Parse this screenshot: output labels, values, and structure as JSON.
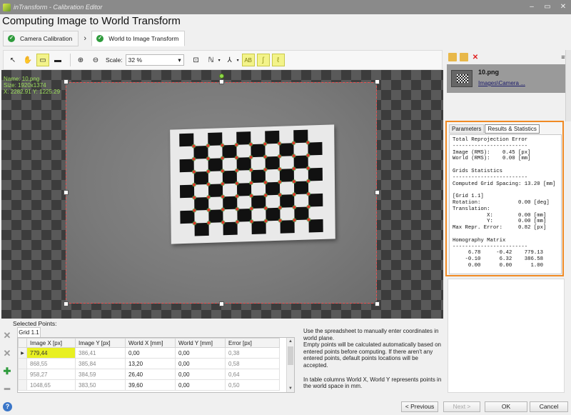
{
  "window": {
    "title": "inTransform - Calibration Editor",
    "controls": [
      "–",
      "▭",
      "✕"
    ]
  },
  "heading": "Computing Image to World Transform",
  "breadcrumb": [
    {
      "label": "Camera Calibration"
    },
    {
      "label": "World to Image Transform"
    }
  ],
  "toolbar": {
    "scale_label": "Scale:",
    "scale_value": "32 %",
    "ab_label": "AB"
  },
  "canvas": {
    "info_name": "Name: 10.png",
    "info_size": "Size: 1920x1374",
    "info_xy": "X: 2282.91 Y: 1225.29"
  },
  "points": {
    "title": "Selected Points:",
    "grid_tab": "Grid 1.1",
    "columns": [
      "Image X [px]",
      "Image Y [px]",
      "World X [mm]",
      "World Y [mm]",
      "Error [px]"
    ],
    "rows": [
      [
        "779,44",
        "386,41",
        "0,00",
        "0,00",
        "0,38"
      ],
      [
        "868,55",
        "385,84",
        "13,20",
        "0,00",
        "0,58"
      ],
      [
        "958,27",
        "384,59",
        "26,40",
        "0,00",
        "0,64"
      ],
      [
        "1048,65",
        "383,50",
        "39,60",
        "0,00",
        "0,50"
      ]
    ]
  },
  "help": {
    "p1": "Use the spreadsheet to manually enter coordinates in world plane.",
    "p2": "Empty points will be calculated automatically based on entered points before computing. If there aren't any entered points, default points locations will be accepted.",
    "p3": "In table columns World X, World Y represents points in the world space in mm."
  },
  "image_list": {
    "name": "10.png",
    "path": "Images\\Camera ..."
  },
  "stats": {
    "tabs": [
      "Parameters",
      "Results & Statistics"
    ],
    "text": "Total Reprojection Error\n------------------------\nImage (RMS):    0.45 [px]\nWorld (RMS):    0.00 [mm]\n\nGrids Statistics\n------------------------\nComputed Grid Spacing: 13.20 [mm]\n\n[Grid 1.1]\nRotation:            0.00 [deg]\nTranslation:\n           X:        0.00 [mm]\n           Y:        0.00 [mm]\nMax Repr. Error:     0.82 [px]\n\nHomography Matrix\n------------------------\n     6.78     -0.42    779.13\n    -0.10      6.32    386.58\n     0.00      0.00      1.00"
  },
  "buttons": {
    "previous": "< Previous",
    "next": "Next >",
    "ok": "OK",
    "cancel": "Cancel"
  },
  "colors": {
    "highlight": "#e8f022",
    "stats_border": "#f08a24",
    "check": "#2e9b3c"
  }
}
